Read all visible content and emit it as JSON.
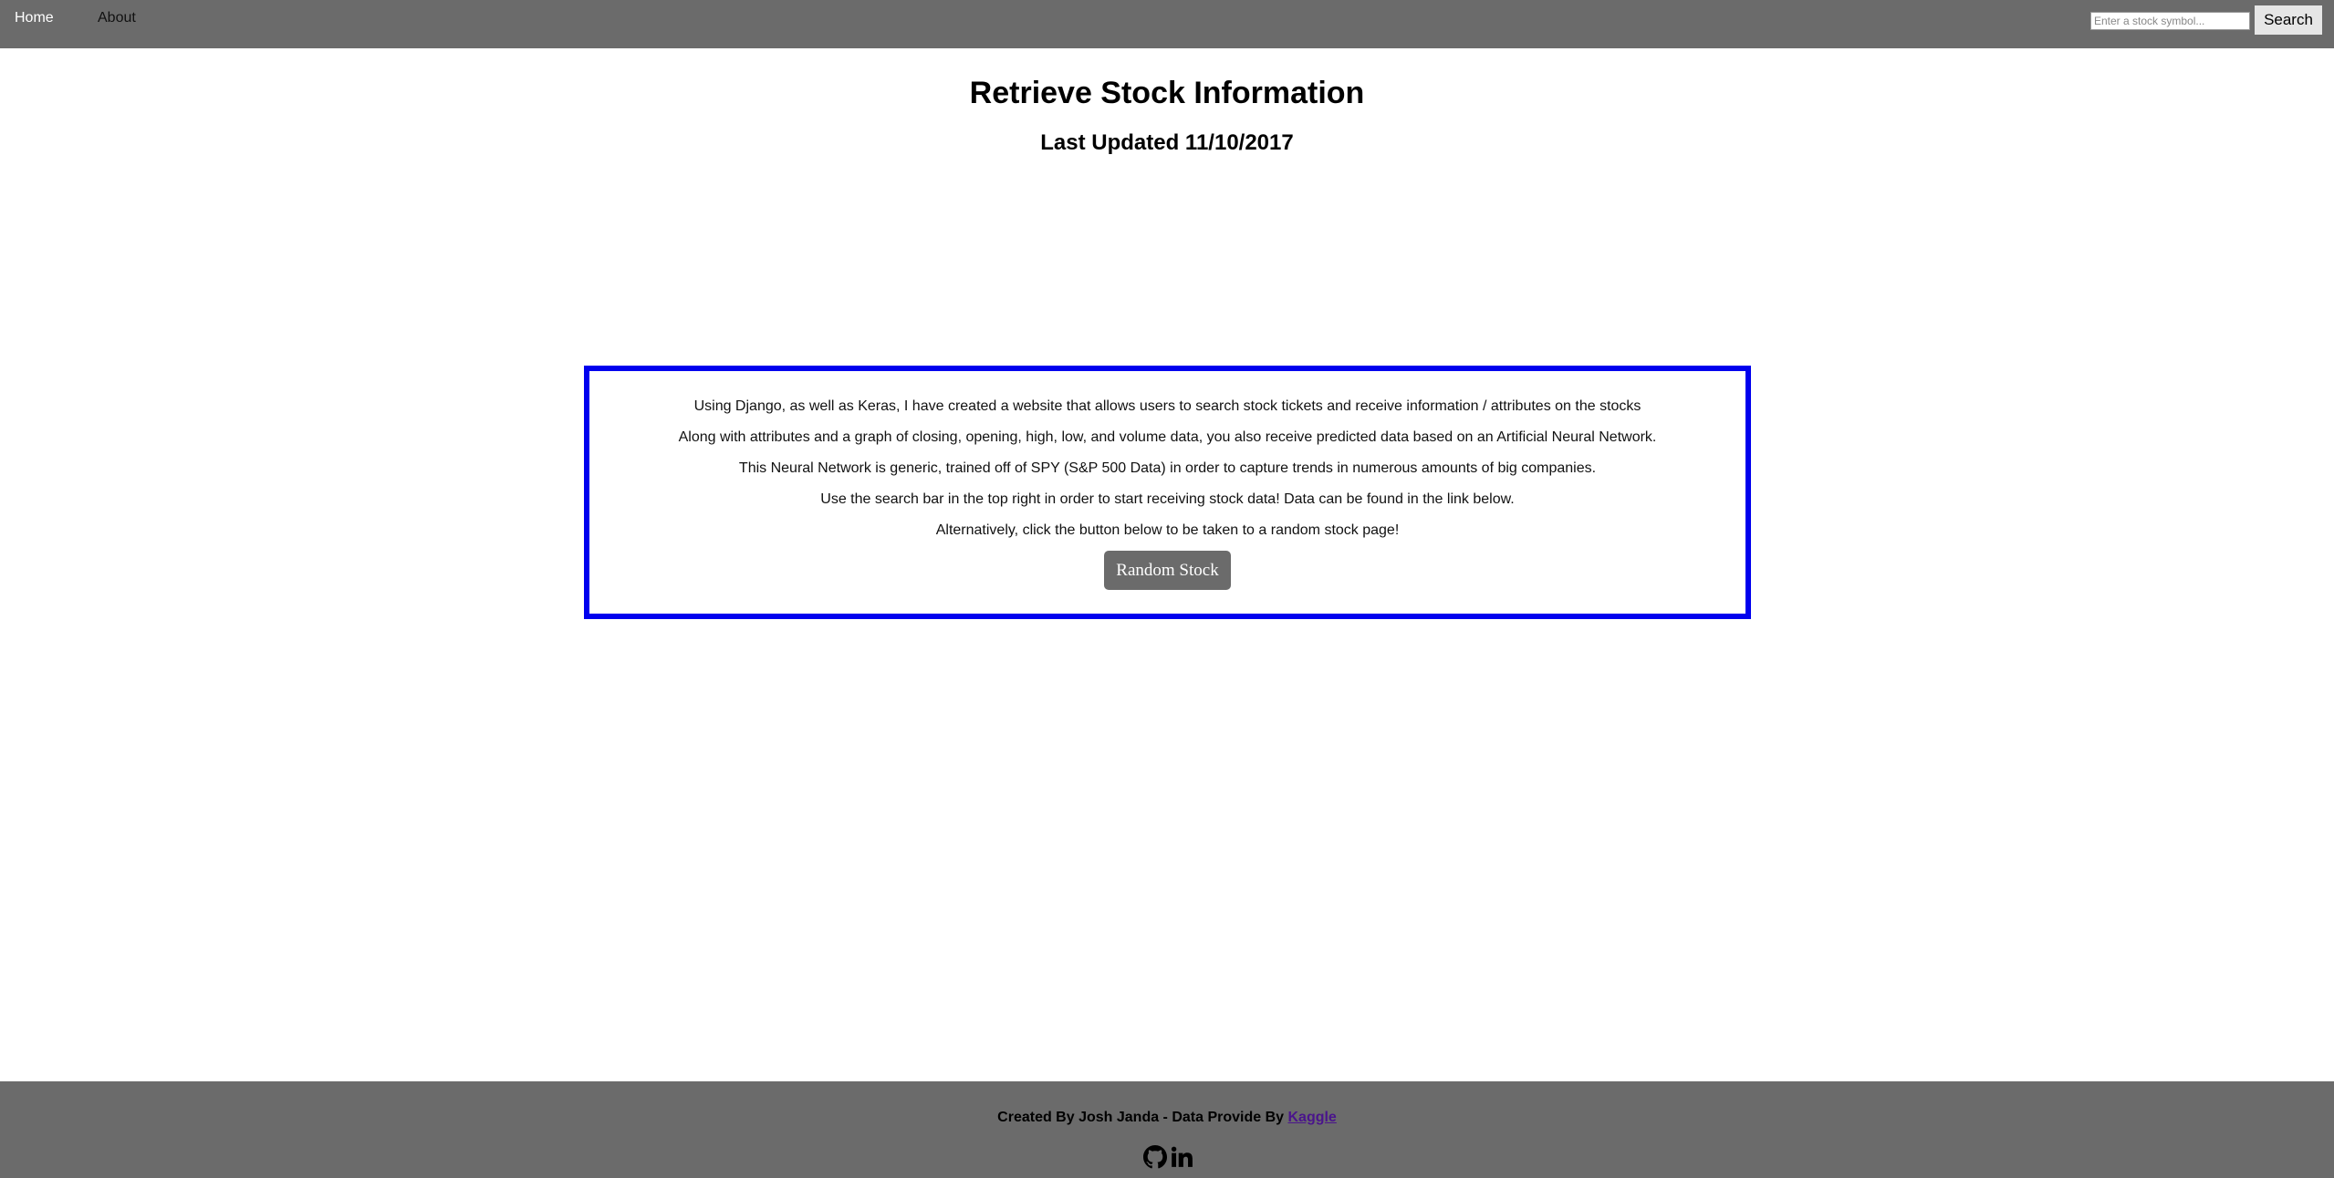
{
  "nav": {
    "home_label": "Home",
    "about_label": "About"
  },
  "search": {
    "placeholder": "Enter a stock symbol...",
    "value": "",
    "button_label": "Search"
  },
  "main": {
    "title": "Retrieve Stock Information",
    "subtitle": "Last Updated 11/10/2017"
  },
  "info": {
    "lines": [
      "Using Django, as well as Keras, I have created a website that allows users to search stock tickets and receive information / attributes on the stocks",
      "Along with attributes and a graph of closing, opening, high, low, and volume data, you also receive predicted data based on an Artificial Neural Network.",
      "This Neural Network is generic, trained off of SPY (S&P 500 Data) in order to capture trends in numerous amounts of big companies.",
      "Use the search bar in the top right in order to start receiving stock data! Data can be found in the link below.",
      "Alternatively, click the button below to be taken to a random stock page!"
    ],
    "random_button_label": "Random Stock"
  },
  "footer": {
    "credit_text": "Created By Josh Janda - Data Provide By ",
    "link_label": "Kaggle",
    "icons": [
      "github-icon",
      "linkedin-icon"
    ]
  },
  "colors": {
    "nav_bg": "#6b6b6b",
    "info_border": "#0000ee",
    "button_bg": "#6b6b6b",
    "footer_link": "#4a148c"
  }
}
